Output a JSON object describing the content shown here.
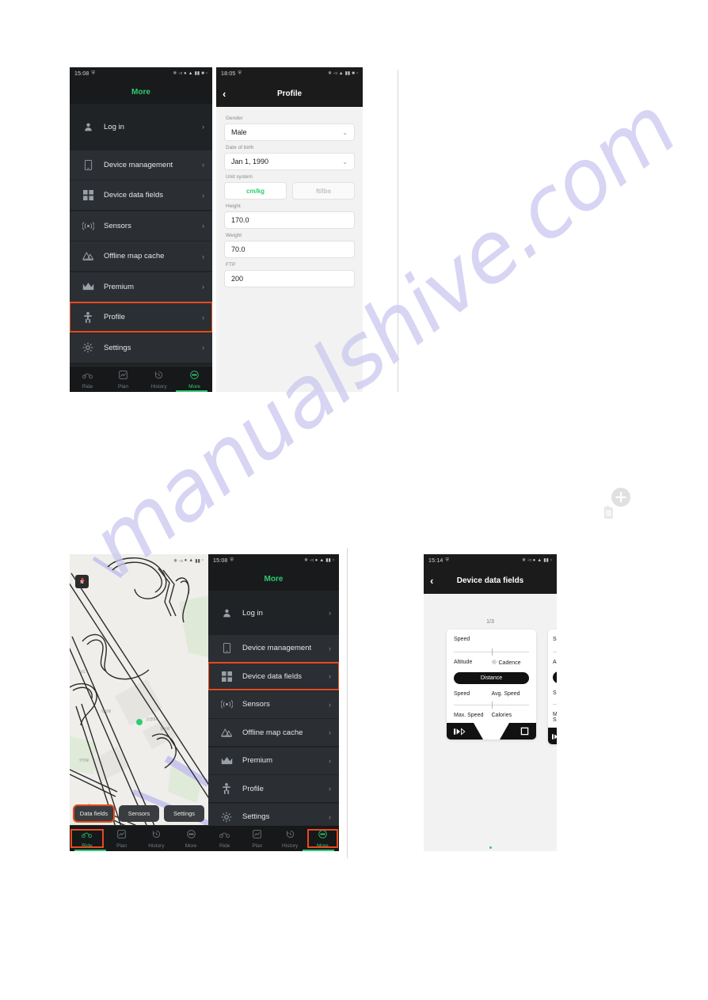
{
  "watermark": {
    "text": "manualshive.com",
    "color": "#c8c6ef",
    "icon": "add-delete-icon"
  },
  "panels": {
    "top_more": {
      "status": {
        "time": "15:08",
        "icons": [
          "bluetooth-icon",
          "mute-icon",
          "location-icon",
          "wifi-icon",
          "sim-icon",
          "signal-icon",
          "battery-icon"
        ]
      },
      "header": {
        "title": "More",
        "color": "#2ecc71"
      },
      "items": [
        {
          "label": "Log in",
          "icon": "person-icon",
          "chevron": "›",
          "style": "plain",
          "highlight": false
        },
        {
          "label": "Device management",
          "icon": "phone-icon",
          "chevron": "›",
          "style": "card",
          "highlight": false
        },
        {
          "label": "Device data fields",
          "icon": "grid-icon",
          "chevron": "›",
          "style": "card",
          "highlight": false
        },
        {
          "label": "Sensors",
          "icon": "signal-wave-icon",
          "chevron": "›",
          "style": "card",
          "highlight": false
        },
        {
          "label": "Offline map cache",
          "icon": "map-stack-icon",
          "chevron": "›",
          "style": "card",
          "highlight": false
        },
        {
          "label": "Premium",
          "icon": "crown-icon",
          "chevron": "›",
          "style": "card",
          "highlight": false
        },
        {
          "label": "Profile",
          "icon": "body-icon",
          "chevron": "›",
          "style": "card",
          "highlight": true
        },
        {
          "label": "Settings",
          "icon": "gear-icon",
          "chevron": "›",
          "style": "card",
          "highlight": false
        }
      ],
      "tabs": [
        {
          "label": "Ride",
          "icon": "bike-icon",
          "active": false
        },
        {
          "label": "Plan",
          "icon": "route-icon",
          "active": false
        },
        {
          "label": "History",
          "icon": "history-icon",
          "active": false
        },
        {
          "label": "More",
          "icon": "more-dots-icon",
          "active": true
        }
      ]
    },
    "top_profile": {
      "status": {
        "time": "18:05"
      },
      "header": {
        "title": "Profile",
        "back": "‹"
      },
      "fields": [
        {
          "label": "Gender",
          "value": "Male",
          "type": "select"
        },
        {
          "label": "Date of birth",
          "value": "Jan 1, 1990",
          "type": "select"
        },
        {
          "label": "Unit system",
          "type": "segment",
          "options": [
            "cm/kg",
            "ft/lbs"
          ],
          "selected": "cm/kg"
        },
        {
          "label": "Height",
          "value": "170.0",
          "type": "text"
        },
        {
          "label": "Weight",
          "value": "70.0",
          "type": "text"
        },
        {
          "label": "FTP",
          "value": "200",
          "type": "text"
        }
      ]
    },
    "bottom_map": {
      "compass": {
        "label": "N"
      },
      "chips": [
        {
          "label": "Data fields",
          "highlight": true
        },
        {
          "label": "Sensors",
          "highlight": false
        },
        {
          "label": "Settings",
          "highlight": false
        }
      ],
      "tabs": [
        {
          "label": "Ride",
          "icon": "bike-icon",
          "active": true,
          "highlight": true
        },
        {
          "label": "Plan",
          "icon": "route-icon",
          "active": false,
          "highlight": false
        },
        {
          "label": "History",
          "icon": "history-icon",
          "active": false,
          "highlight": false
        },
        {
          "label": "More",
          "icon": "more-dots-icon",
          "active": false,
          "highlight": false
        }
      ]
    },
    "bottom_more": {
      "status": {
        "time": "15:08"
      },
      "header": {
        "title": "More",
        "color": "#2ecc71"
      },
      "items": [
        {
          "label": "Log in",
          "icon": "person-icon",
          "chevron": "›",
          "style": "plain",
          "highlight": false
        },
        {
          "label": "Device management",
          "icon": "phone-icon",
          "chevron": "›",
          "style": "card",
          "highlight": false
        },
        {
          "label": "Device data fields",
          "icon": "grid-icon",
          "chevron": "›",
          "style": "card",
          "highlight": true
        },
        {
          "label": "Sensors",
          "icon": "signal-wave-icon",
          "chevron": "›",
          "style": "card",
          "highlight": false
        },
        {
          "label": "Offline map cache",
          "icon": "map-stack-icon",
          "chevron": "›",
          "style": "card",
          "highlight": false
        },
        {
          "label": "Premium",
          "icon": "crown-icon",
          "chevron": "›",
          "style": "card",
          "highlight": false
        },
        {
          "label": "Profile",
          "icon": "body-icon",
          "chevron": "›",
          "style": "card",
          "highlight": false
        },
        {
          "label": "Settings",
          "icon": "gear-icon",
          "chevron": "›",
          "style": "card",
          "highlight": false
        }
      ],
      "tabs": [
        {
          "label": "Ride",
          "icon": "bike-icon",
          "active": false,
          "highlight": false
        },
        {
          "label": "Plan",
          "icon": "route-icon",
          "active": false,
          "highlight": false
        },
        {
          "label": "History",
          "icon": "history-icon",
          "active": false,
          "highlight": false
        },
        {
          "label": "More",
          "icon": "more-dots-icon",
          "active": true,
          "highlight": true
        }
      ]
    },
    "bottom_datafields": {
      "status": {
        "time": "15:14"
      },
      "header": {
        "title": "Device data fields",
        "back": "‹"
      },
      "page_indicator": "1/3",
      "card": {
        "top_field": "Speed",
        "mid_row": [
          "Altitude",
          "Cadence"
        ],
        "pill": "Distance",
        "row2": [
          "Speed",
          "Avg. Speed"
        ],
        "row3": [
          "Max. Speed",
          "Calories"
        ]
      },
      "actions": [
        {
          "name": "add-button",
          "icon": "plus-circle-icon",
          "highlight": true
        },
        {
          "name": "delete-button",
          "icon": "trash-icon",
          "highlight": true
        }
      ]
    }
  }
}
